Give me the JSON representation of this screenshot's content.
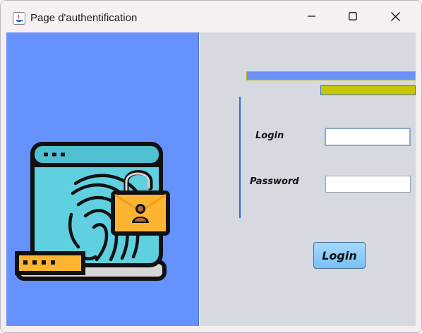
{
  "window": {
    "title": "Page d'authentification",
    "icon": "java-app-icon",
    "controls": [
      "minimize-icon",
      "maximize-icon",
      "close-icon"
    ]
  },
  "illustration": {
    "icon": "fingerprint-laptop-lock-icon",
    "colors": {
      "panel": "#6592fd",
      "screen": "#5ed0e0",
      "lock": "#fdb531",
      "outline": "#111111"
    }
  },
  "form": {
    "login_label": "Login",
    "login_value": "",
    "password_label": "Password",
    "password_value": "",
    "submit_label": "Login"
  },
  "colors": {
    "accent_blue": "#6a92f4",
    "accent_yellow": "#c6c606",
    "divider": "#2d6be3",
    "button": "#86c8f8",
    "form_background": "#d6d9e0"
  }
}
